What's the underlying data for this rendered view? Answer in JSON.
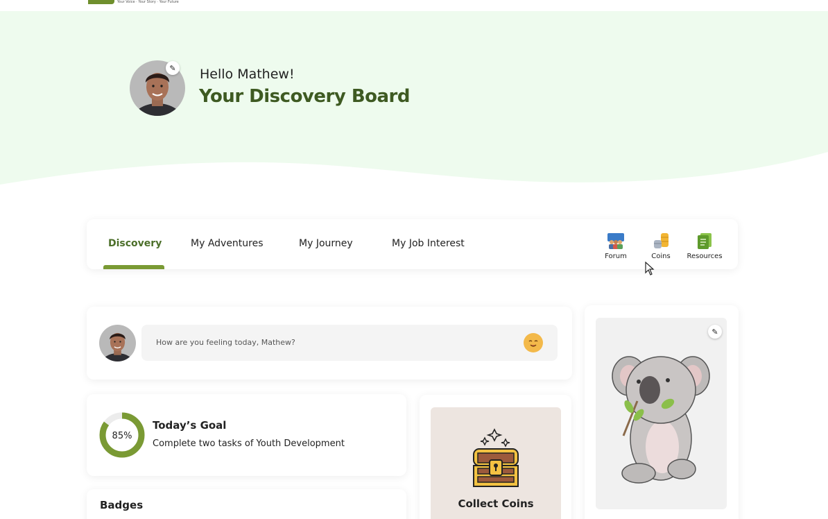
{
  "header": {
    "tagline": "Your Voice · Your Story · Your Future"
  },
  "hero": {
    "greeting": "Hello Mathew!",
    "title": "Your Discovery Board"
  },
  "tabs": [
    {
      "label": "Discovery",
      "active": true
    },
    {
      "label": "My Adventures",
      "active": false
    },
    {
      "label": "My Journey",
      "active": false
    },
    {
      "label": "My Job Interest",
      "active": false
    }
  ],
  "quick_links": [
    {
      "label": "Forum",
      "icon": "forum-icon"
    },
    {
      "label": "Coins",
      "icon": "coins-icon"
    },
    {
      "label": "Resources",
      "icon": "resources-icon"
    }
  ],
  "mood": {
    "placeholder": "How are you feeling today, Mathew?",
    "icon": "smiley-emoji-icon"
  },
  "goal": {
    "progress_percent": 85,
    "progress_label": "85%",
    "title": "Today’s Goal",
    "description": "Complete two tasks of Youth Development"
  },
  "badges": {
    "title": "Badges"
  },
  "coins": {
    "label": "Collect Coins",
    "icon": "treasure-chest-icon"
  },
  "colors": {
    "hero_bg": "#eefbee",
    "accent_green": "#7a9a34",
    "title_green": "#3e5a22",
    "progress_track": "#ececec"
  }
}
